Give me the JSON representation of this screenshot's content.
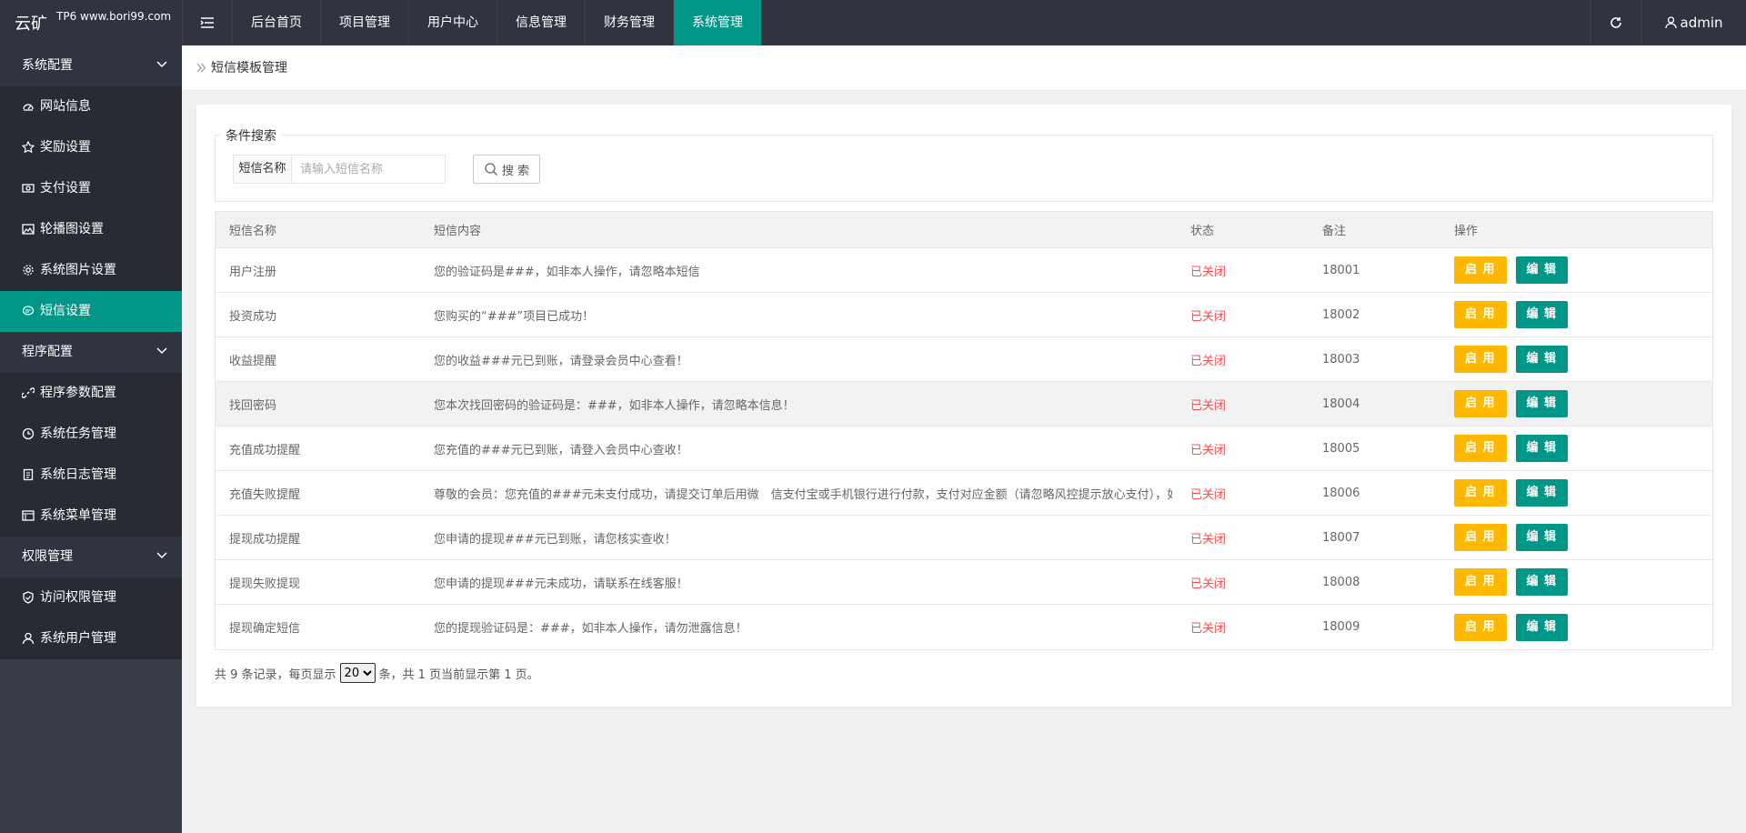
{
  "header": {
    "logo_main": "云矿",
    "logo_sub": "TP6 www.bori99.com",
    "nav": [
      "后台首页",
      "项目管理",
      "用户中心",
      "信息管理",
      "财务管理",
      "系统管理"
    ],
    "active_nav": "系统管理",
    "user": "admin"
  },
  "sidebar": {
    "groups": [
      {
        "label": "系统配置",
        "items": [
          {
            "label": "网站信息",
            "icon": "dashboard-icon"
          },
          {
            "label": "奖励设置",
            "icon": "star-icon"
          },
          {
            "label": "支付设置",
            "icon": "money-icon"
          },
          {
            "label": "轮播图设置",
            "icon": "image-icon"
          },
          {
            "label": "系统图片设置",
            "icon": "gear-icon"
          },
          {
            "label": "短信设置",
            "icon": "message-icon",
            "active": true
          }
        ]
      },
      {
        "label": "程序配置",
        "items": [
          {
            "label": "程序参数配置",
            "icon": "link-icon"
          },
          {
            "label": "系统任务管理",
            "icon": "clock-icon"
          },
          {
            "label": "系统日志管理",
            "icon": "log-icon"
          },
          {
            "label": "系统菜单管理",
            "icon": "menu-icon"
          }
        ]
      },
      {
        "label": "权限管理",
        "items": [
          {
            "label": "访问权限管理",
            "icon": "shield-icon"
          },
          {
            "label": "系统用户管理",
            "icon": "user-icon"
          }
        ]
      }
    ]
  },
  "breadcrumb": "短信模板管理",
  "search": {
    "legend": "条件搜索",
    "label": "短信名称",
    "placeholder": "请输入短信名称",
    "button": "搜 索"
  },
  "table": {
    "headers": [
      "短信名称",
      "短信内容",
      "状态",
      "备注",
      "操作"
    ],
    "rows": [
      {
        "name": "用户注册",
        "content": "您的验证码是###，如非本人操作，请忽略本短信",
        "status": "已关闭",
        "note": "18001"
      },
      {
        "name": "投资成功",
        "content": "您购买的“###”项目已成功！",
        "status": "已关闭",
        "note": "18002"
      },
      {
        "name": "收益提醒",
        "content": "您的收益###元已到账，请登录会员中心查看！",
        "status": "已关闭",
        "note": "18003"
      },
      {
        "name": "找回密码",
        "content": "您本次找回密码的验证码是：###，如非本人操作，请忽略本信息！",
        "status": "已关闭",
        "note": "18004"
      },
      {
        "name": "充值成功提醒",
        "content": "您充值的###元已到账，请登入会员中心查收！",
        "status": "已关闭",
        "note": "18005"
      },
      {
        "name": "充值失败提醒",
        "content": "尊敬的会员：您充值的###元未支付成功，请提交订单后用微　信支付宝或手机银行进行付款，支付对应金额（请忽略风控提示放心支付），如有疑问，请联系在线客服！",
        "status": "已关闭",
        "note": "18006"
      },
      {
        "name": "提现成功提醒",
        "content": "您申请的提现###元已到账，请您核实查收！",
        "status": "已关闭",
        "note": "18007"
      },
      {
        "name": "提现失败提现",
        "content": "您申请的提现###元未成功，请联系在线客服！",
        "status": "已关闭",
        "note": "18008"
      },
      {
        "name": "提现确定短信",
        "content": "您的提现验证码是：###，如非本人操作，请勿泄露信息！",
        "status": "已关闭",
        "note": "18009"
      }
    ],
    "btn_enable": "启 用",
    "btn_edit": "编 辑"
  },
  "pager": {
    "prefix": "共 9 条记录，每页显示",
    "page_size": "20",
    "suffix": "条，共 1 页当前显示第 1 页。"
  },
  "colors": {
    "accent": "#009688",
    "warn": "#ffb800",
    "status_off": "#ff4d4f",
    "topbar": "#2f3440"
  }
}
